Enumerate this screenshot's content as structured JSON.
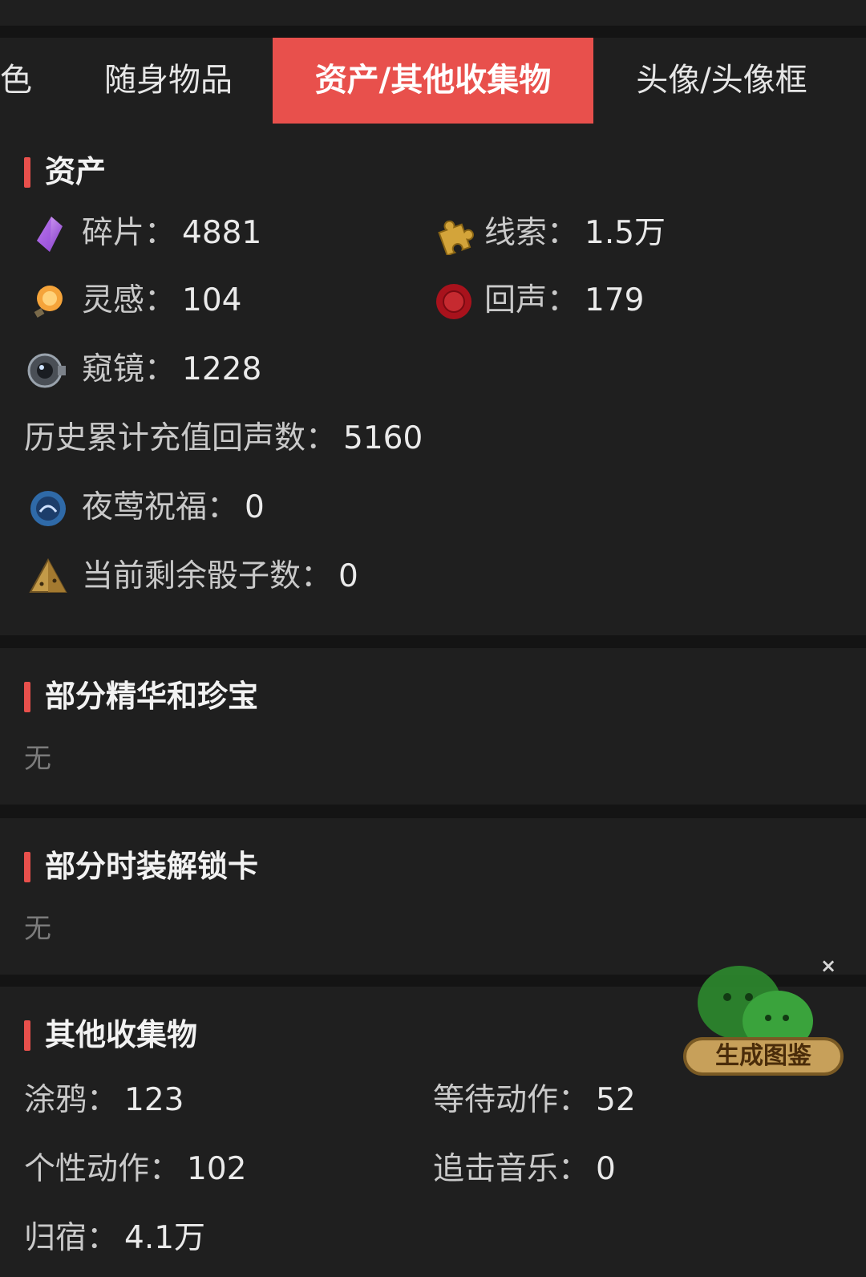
{
  "tabs": [
    {
      "label": "色",
      "active": false
    },
    {
      "label": "随身物品",
      "active": false
    },
    {
      "label": "资产/其他收集物",
      "active": true
    },
    {
      "label": "头像/头像框",
      "active": false
    }
  ],
  "assets": {
    "title": "资产",
    "items": [
      {
        "icon": "crystal-shard-icon",
        "label": "碎片：",
        "value": "4881"
      },
      {
        "icon": "puzzle-piece-icon",
        "label": "线索：",
        "value": "1.5万"
      },
      {
        "icon": "inspiration-orb-icon",
        "label": "灵感：",
        "value": "104"
      },
      {
        "icon": "wax-seal-icon",
        "label": "回声：",
        "value": "179"
      },
      {
        "icon": "lens-icon",
        "label": "窥镜：",
        "value": "1228"
      },
      {
        "icon": "",
        "label": "历史累计充值回声数：",
        "value": "5160"
      },
      {
        "icon": "nightingale-orb-icon",
        "label": "夜莺祝福：",
        "value": "0"
      },
      {
        "icon": "dice-icon",
        "label": "当前剩余骰子数：",
        "value": "0"
      }
    ]
  },
  "essence": {
    "title": "部分精华和珍宝",
    "empty": "无"
  },
  "costume": {
    "title": "部分时装解锁卡",
    "empty": "无"
  },
  "collect": {
    "title": "其他收集物",
    "items": [
      {
        "label": "涂鸦：",
        "value": "123"
      },
      {
        "label": "等待动作：",
        "value": "52"
      },
      {
        "label": "个性动作：",
        "value": "102"
      },
      {
        "label": "追击音乐：",
        "value": "0"
      },
      {
        "label": "归宿：",
        "value": "4.1万"
      }
    ]
  },
  "float_button": {
    "label": "生成图鉴",
    "close": "×"
  }
}
